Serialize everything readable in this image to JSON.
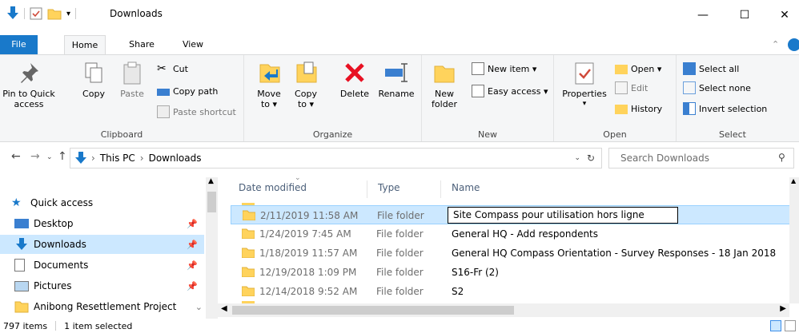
{
  "window": {
    "title": "Downloads",
    "min": "—",
    "max": "☐",
    "close": "✕"
  },
  "tabs": {
    "file": "File",
    "home": "Home",
    "share": "Share",
    "view": "View"
  },
  "ribbon": {
    "clipboard": {
      "label": "Clipboard",
      "pin": "Pin to Quick access",
      "copy": "Copy",
      "paste": "Paste",
      "cut": "Cut",
      "copy_path": "Copy path",
      "paste_shortcut": "Paste shortcut"
    },
    "organize": {
      "label": "Organize",
      "move_to": "Move to ▾",
      "copy_to": "Copy to ▾",
      "delete": "Delete",
      "rename": "Rename"
    },
    "new": {
      "label": "New",
      "new_folder": "New folder",
      "new_item": "New item ▾",
      "easy_access": "Easy access ▾"
    },
    "open": {
      "label": "Open",
      "properties": "Properties",
      "open": "Open ▾",
      "edit": "Edit",
      "history": "History"
    },
    "select": {
      "label": "Select",
      "select_all": "Select all",
      "select_none": "Select none",
      "invert": "Invert selection"
    }
  },
  "address": {
    "this_pc": "This PC",
    "sep": "›",
    "downloads": "Downloads",
    "search_placeholder": "Search Downloads"
  },
  "nav": {
    "items": [
      {
        "label": "Quick access",
        "icon": "star-icon"
      },
      {
        "label": "Desktop",
        "icon": "desktop-icon"
      },
      {
        "label": "Downloads",
        "icon": "download-icon"
      },
      {
        "label": "Documents",
        "icon": "documents-icon"
      },
      {
        "label": "Pictures",
        "icon": "pictures-icon"
      },
      {
        "label": "Anibong Resettlement Project",
        "icon": "folder-icon"
      }
    ]
  },
  "columns": {
    "date": "Date modified",
    "type": "Type",
    "name": "Name"
  },
  "files": [
    {
      "date": "2/11/2019 11:58 AM",
      "type": "File folder",
      "name": "Site Compass pour utilisation hors ligne",
      "selected": true
    },
    {
      "date": "1/24/2019 7:45 AM",
      "type": "File folder",
      "name": "General HQ - Add respondents"
    },
    {
      "date": "1/18/2019 11:57 AM",
      "type": "File folder",
      "name": "General HQ Compass Orientation - Survey Responses - 18 Jan 2018"
    },
    {
      "date": "12/19/2018 1:09 PM",
      "type": "File folder",
      "name": "S16-Fr (2)"
    },
    {
      "date": "12/14/2018 9:52 AM",
      "type": "File folder",
      "name": "S2"
    }
  ],
  "status": {
    "count": "797 items",
    "selected": "1 item selected"
  },
  "colors": {
    "accent": "#1979ca",
    "selection": "#cce8ff",
    "folder": "#ffd35c"
  }
}
